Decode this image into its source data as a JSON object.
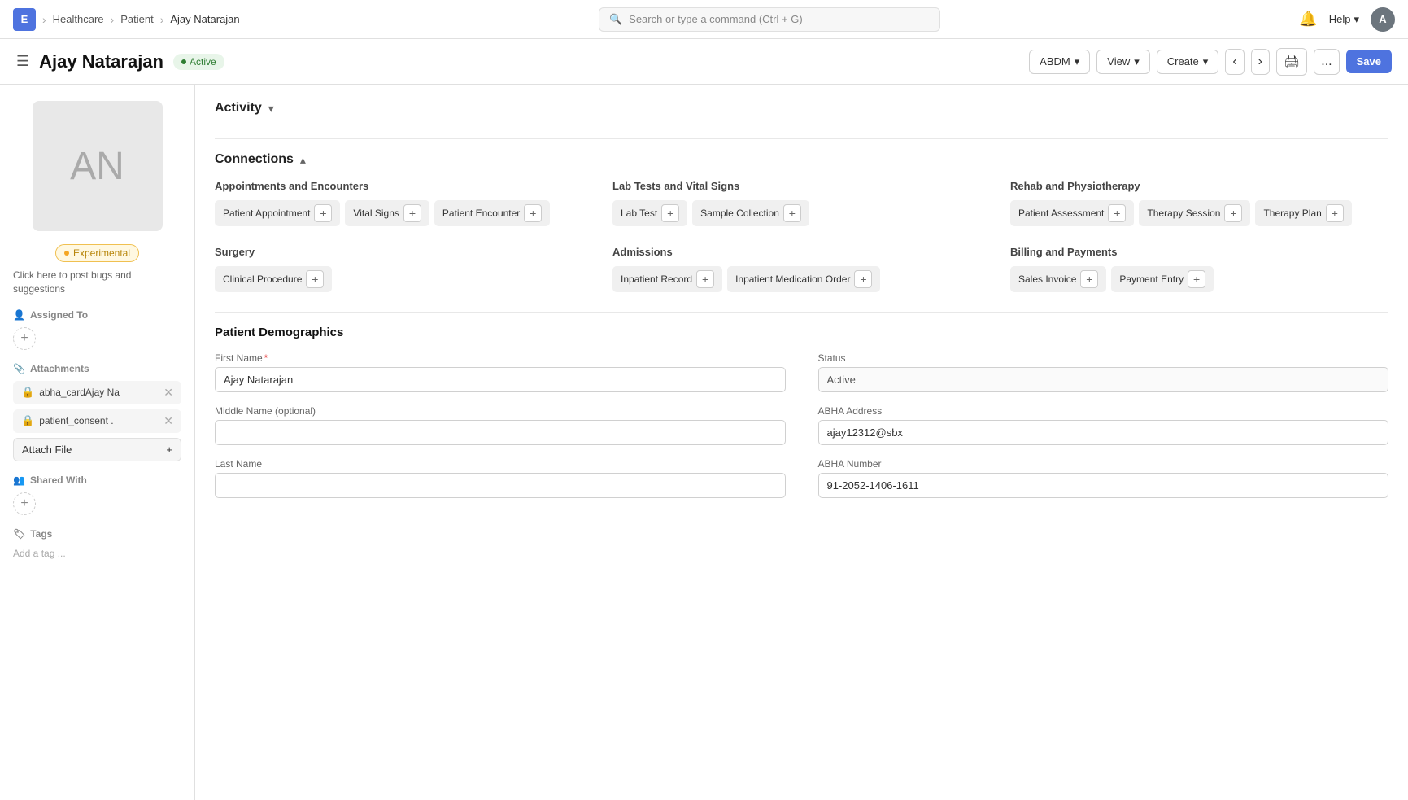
{
  "topNav": {
    "logo": "E",
    "breadcrumbs": [
      "Healthcare",
      "Patient",
      "Ajay Natarajan"
    ],
    "search_placeholder": "Search or type a command (Ctrl + G)",
    "help_label": "Help",
    "avatar_initials": "A"
  },
  "subHeader": {
    "page_title": "Ajay Natarajan",
    "status_label": "Active",
    "buttons": {
      "abdm": "ABDM",
      "view": "View",
      "create": "Create",
      "save": "Save",
      "more": "..."
    }
  },
  "sidebar": {
    "avatar_initials": "AN",
    "experimental_label": "Experimental",
    "hint_text": "Click here to post bugs and suggestions",
    "assigned_to_label": "Assigned To",
    "attachments_label": "Attachments",
    "attachments": [
      {
        "name": "abha_cardAjay Na"
      },
      {
        "name": "patient_consent ."
      }
    ],
    "attach_file_label": "Attach File",
    "shared_with_label": "Shared With",
    "tags_label": "Tags",
    "add_tag_placeholder": "Add a tag ..."
  },
  "activity": {
    "section_label": "Activity"
  },
  "connections": {
    "section_label": "Connections",
    "groups": [
      {
        "title": "Appointments and Encounters",
        "items": [
          "Patient Appointment",
          "Vital Signs",
          "Patient Encounter"
        ]
      },
      {
        "title": "Lab Tests and Vital Signs",
        "items": [
          "Lab Test",
          "Sample Collection"
        ]
      },
      {
        "title": "Rehab and Physiotherapy",
        "items": [
          "Patient Assessment",
          "Therapy Session",
          "Therapy Plan"
        ]
      },
      {
        "title": "Surgery",
        "items": [
          "Clinical Procedure"
        ]
      },
      {
        "title": "Admissions",
        "items": [
          "Inpatient Record",
          "Inpatient Medication Order"
        ]
      },
      {
        "title": "Billing and Payments",
        "items": [
          "Sales Invoice",
          "Payment Entry"
        ]
      }
    ]
  },
  "demographics": {
    "section_title": "Patient Demographics",
    "fields": [
      {
        "label": "First Name",
        "required": true,
        "value": "Ajay Natarajan",
        "id": "first-name",
        "col": 0
      },
      {
        "label": "Status",
        "required": false,
        "value": "Active",
        "id": "status",
        "col": 1
      },
      {
        "label": "Middle Name (optional)",
        "required": false,
        "value": "",
        "id": "middle-name",
        "col": 0
      },
      {
        "label": "ABHA Address",
        "required": false,
        "value": "ajay12312@sbx",
        "id": "abha-address",
        "col": 1
      },
      {
        "label": "Last Name",
        "required": false,
        "value": "",
        "id": "last-name",
        "col": 0
      },
      {
        "label": "ABHA Number",
        "required": false,
        "value": "91-2052-1406-1611",
        "id": "abha-number",
        "col": 1
      }
    ]
  }
}
